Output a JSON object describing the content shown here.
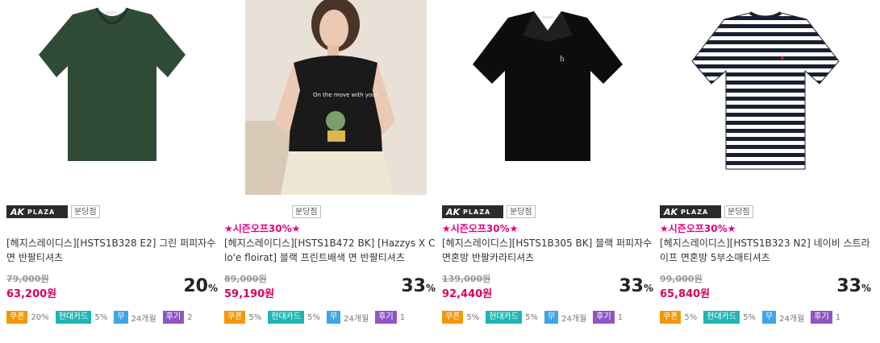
{
  "products": [
    {
      "store_logo": "PLAZA",
      "branch": "분당점",
      "promo": "",
      "title": "[헤지스레이디스][HSTS1B328 E2] 그린 퍼피자수 면 반팔티셔츠",
      "original_price": "79,000원",
      "sale_price": "63,200원",
      "discount": "20",
      "discount_unit": "%",
      "coupon_label": "쿠폰",
      "coupon_value": "20%",
      "card_label": "현대카드",
      "card_value": "5%",
      "installment_label": "무",
      "installment_value": "24개월",
      "review_label": "후기",
      "review_count": "2",
      "image": "green-vneck-tshirt"
    },
    {
      "store_logo": "",
      "branch": "분당점",
      "promo": "★시즌오프30%★",
      "title": "[헤지스레이디스][HSTS1B472 BK] [Hazzys X Clo'e floirat] 블랙 프린트배색 면 반팔티셔츠",
      "original_price": "89,000원",
      "sale_price": "59,190원",
      "discount": "33",
      "discount_unit": "%",
      "coupon_label": "쿠폰",
      "coupon_value": "5%",
      "card_label": "현대카드",
      "card_value": "5%",
      "installment_label": "무",
      "installment_value": "24개월",
      "review_label": "후기",
      "review_count": "1",
      "image": "model-black-print-tshirt"
    },
    {
      "store_logo": "PLAZA",
      "branch": "분당점",
      "promo": "★시즌오프30%★",
      "title": "[헤지스레이디스][HSTS1B305 BK] 블랙 퍼피자수 면혼방 반팔카라티셔츠",
      "original_price": "139,000원",
      "sale_price": "92,440원",
      "discount": "33",
      "discount_unit": "%",
      "coupon_label": "쿠폰",
      "coupon_value": "5%",
      "card_label": "현대카드",
      "card_value": "5%",
      "installment_label": "무",
      "installment_value": "24개월",
      "review_label": "후기",
      "review_count": "1",
      "image": "black-collar-polo"
    },
    {
      "store_logo": "PLAZA",
      "branch": "분당점",
      "promo": "★시즌오프30%★",
      "title": "[헤지스레이디스][HSTS1B323 N2] 네이비 스트라이프 면혼방 5부소매티셔츠",
      "original_price": "99,000원",
      "sale_price": "65,840원",
      "discount": "33",
      "discount_unit": "%",
      "coupon_label": "쿠폰",
      "coupon_value": "5%",
      "card_label": "현대카드",
      "card_value": "5%",
      "installment_label": "무",
      "installment_value": "24개월",
      "review_label": "후기",
      "review_count": "1",
      "image": "navy-stripe-tshirt"
    }
  ],
  "colors": {
    "promo": "#e3007f",
    "sale_price": "#d6005f",
    "coupon": "#f39800",
    "card": "#1fb5b3",
    "installment": "#3fa4e8",
    "review": "#8e56c3"
  }
}
